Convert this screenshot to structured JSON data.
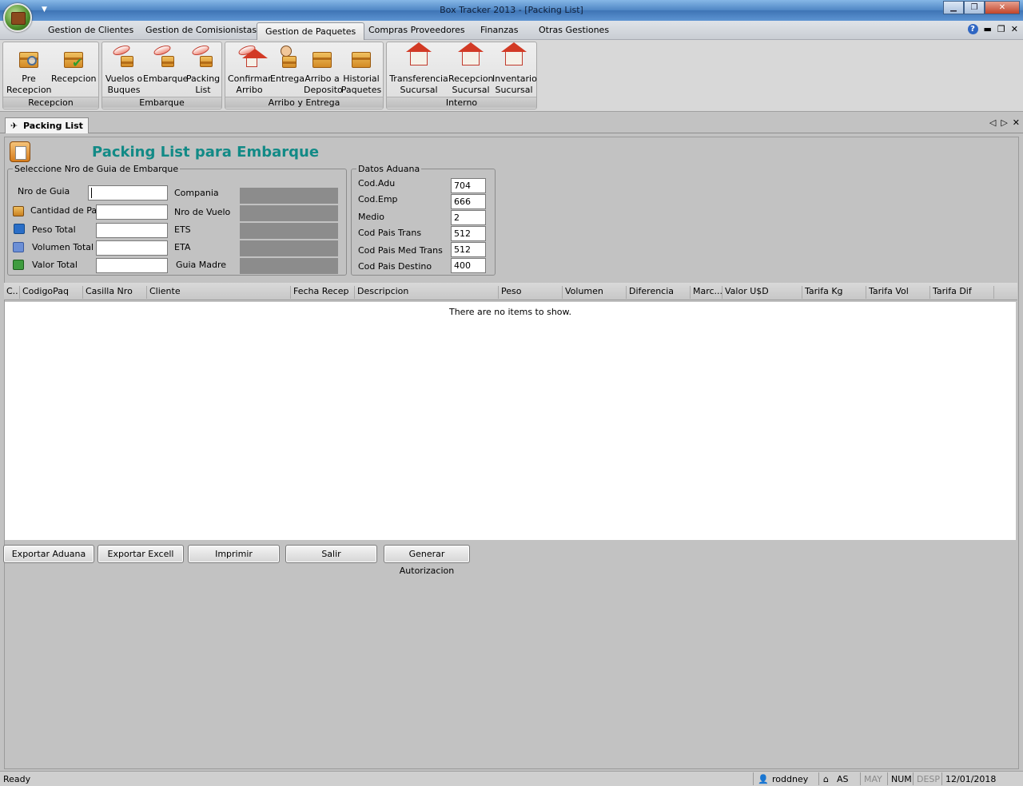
{
  "window": {
    "title": "Box Tracker 2013 - [Packing List]",
    "controls": {
      "minimize": "▁",
      "maximize": "❐",
      "close": "✕"
    }
  },
  "menu": {
    "tabs": [
      "Gestion de Clientes",
      "Gestion de Comisionistas",
      "Gestion de Paquetes",
      "Compras  Proveedores",
      "Finanzas",
      "Otras Gestiones"
    ],
    "active_tab": "Gestion de Paquetes",
    "help": "?"
  },
  "ribbon": {
    "groups": [
      {
        "label": "Recepcion",
        "buttons": [
          {
            "line1": "Pre",
            "line2": "Recepcion",
            "icon": "box-magnifier-icon"
          },
          {
            "line1": "Recepcion",
            "line2": "",
            "icon": "box-check-icon"
          }
        ]
      },
      {
        "label": "Embarque",
        "buttons": [
          {
            "line1": "Vuelos o",
            "line2": "Buques",
            "icon": "plane-icon"
          },
          {
            "line1": "Embarque",
            "line2": "",
            "icon": "plane-box-icon"
          },
          {
            "line1": "Packing",
            "line2": "List",
            "icon": "plane-list-icon"
          }
        ]
      },
      {
        "label": "Arribo y Entrega",
        "buttons": [
          {
            "line1": "Confirmar",
            "line2": "Arribo",
            "icon": "plane-house-icon"
          },
          {
            "line1": "Entrega",
            "line2": "",
            "icon": "person-box-icon"
          },
          {
            "line1": "Arribo a",
            "line2": "Deposito",
            "icon": "house-box-icon"
          },
          {
            "line1": "Historial",
            "line2": "Paquetes",
            "icon": "box-history-icon"
          }
        ]
      },
      {
        "label": "Interno",
        "buttons": [
          {
            "line1": "Transferencia",
            "line2": "Sucursal",
            "icon": "house-transfer-icon"
          },
          {
            "line1": "Recepcion",
            "line2": "Sucursal",
            "icon": "house-receive-icon"
          },
          {
            "line1": "Inventario",
            "line2": "Sucursal",
            "icon": "house-inventory-icon"
          }
        ]
      }
    ]
  },
  "doc_tab": {
    "label": "Packing List"
  },
  "form": {
    "title": "Packing List para Embarque",
    "guia_group": {
      "legend": "Seleccione Nro de Guia de Embarque",
      "labels": [
        "Nro de Guia",
        "Cantidad de Paq",
        "Peso Total",
        "Volumen Total",
        "Valor Total"
      ],
      "right_labels": [
        "Compania",
        "Nro de Vuelo",
        "ETS",
        "ETA",
        "Guia Madre"
      ]
    },
    "aduana_group": {
      "legend": "Datos Aduana",
      "fields": [
        {
          "label": "Cod.Adu",
          "value": "704"
        },
        {
          "label": "Cod.Emp",
          "value": "666"
        },
        {
          "label": "Medio",
          "value": "2"
        },
        {
          "label": "Cod Pais Trans",
          "value": "512"
        },
        {
          "label": "Cod Pais Med Trans",
          "value": "512"
        },
        {
          "label": "Cod Pais Destino",
          "value": "400"
        }
      ]
    }
  },
  "grid": {
    "columns": [
      "C..",
      "CodigoPaq",
      "Casilla Nro",
      "Cliente",
      "Fecha Recep",
      "Descripcion",
      "Peso",
      "Volumen",
      "Diferencia",
      "Marc...",
      "Valor U$D",
      "Tarifa Kg",
      "Tarifa Vol",
      "Tarifa Dif"
    ],
    "empty_text": "There are no items to show."
  },
  "buttons": [
    "Exportar Aduana",
    "Exportar Excell",
    "Imprimir",
    "Salir",
    "Generar Autorizacion"
  ],
  "status": {
    "left": "Ready",
    "user": "roddney",
    "branch": "AS",
    "caps": "MAY",
    "num": "NUM",
    "scroll": "DESP",
    "date": "12/01/2018"
  }
}
